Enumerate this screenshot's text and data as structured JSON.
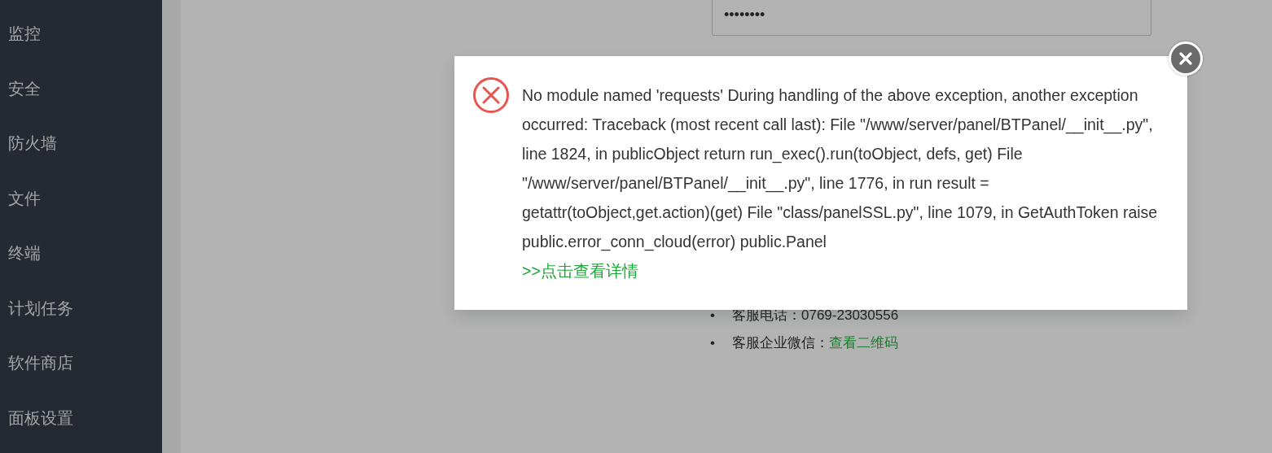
{
  "sidebar": {
    "items": [
      {
        "label": "监控"
      },
      {
        "label": "安全"
      },
      {
        "label": "防火墙"
      },
      {
        "label": "文件"
      },
      {
        "label": "终端"
      },
      {
        "label": "计划任务"
      },
      {
        "label": "软件商店"
      },
      {
        "label": "面板设置"
      }
    ]
  },
  "password_field": {
    "value": "••••••••"
  },
  "contact_list": [
    {
      "marker": "•",
      "label": "客服电话：0769-23030556"
    },
    {
      "marker": "•",
      "label": "客服企业微信：",
      "link": "查看二维码"
    }
  ],
  "dialog": {
    "message": "No module named 'requests' During handling of the above exception, another exception occurred: Traceback (most recent call last): File \"/www/server/panel/BTPanel/__init__.py\", line 1824, in publicObject return run_exec().run(toObject, defs, get) File \"/www/server/panel/BTPanel/__init__.py\", line 1776, in run result = getattr(toObject,get.action)(get) File \"class/panelSSL.py\", line 1079, in GetAuthToken raise public.error_conn_cloud(error) public.Panel",
    "details_link": ">>点击查看详情"
  }
}
